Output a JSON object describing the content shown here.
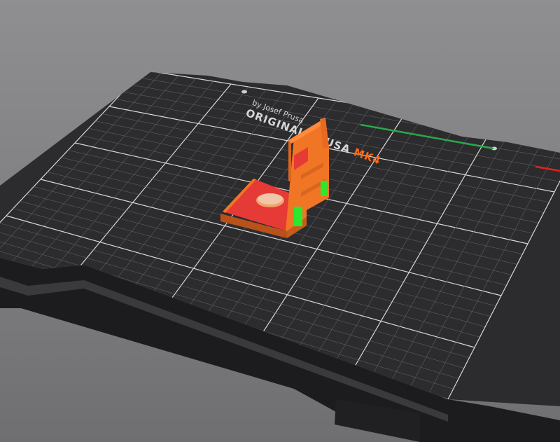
{
  "viewport": {
    "background_top": "#8f8f91",
    "background_mid": "#7e7e80",
    "background_bottom": "#6f6f71"
  },
  "bed": {
    "brand_line": "ORIGINAL PRUSA MK4",
    "brand_prefix": "ORIGINAL PRUSA ",
    "brand_model": "MK4",
    "byline": "by Josef Prusa",
    "colors": {
      "sheet": "#2c2c2e",
      "grid_minor": "#5e5e60",
      "grid_major": "#d8d8d8",
      "model_accent": "#ff6a13",
      "x_axis": "#e02020",
      "y_axis": "#29a84a"
    }
  },
  "model": {
    "name": "bracket",
    "colors": {
      "body": "#f07525",
      "top_face": "#e53a35",
      "supports": "#2ee62e",
      "shade": "#b8521a"
    }
  }
}
